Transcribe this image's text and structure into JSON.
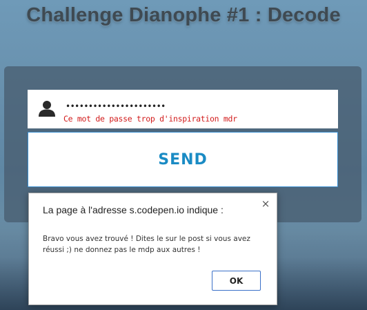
{
  "page": {
    "title": "Challenge Dianophe #1 : Decode"
  },
  "form": {
    "user_icon": "user-icon",
    "password_value": "••••••••••••••••••••••",
    "hint": "Ce mot de passe trop d'inspiration mdr",
    "send_label": "SEND"
  },
  "dialog": {
    "title": "La page à l'adresse s.codepen.io indique :",
    "close_label": "×",
    "message": "Bravo vous avez trouvé ! Dites le sur le post si vous avez réussi ;) ne donnez pas le mdp aux autres !",
    "ok_label": "OK"
  },
  "colors": {
    "send_text": "#1a8bc4",
    "hint_text": "#d21b1b",
    "ok_border": "#3a70c8"
  }
}
